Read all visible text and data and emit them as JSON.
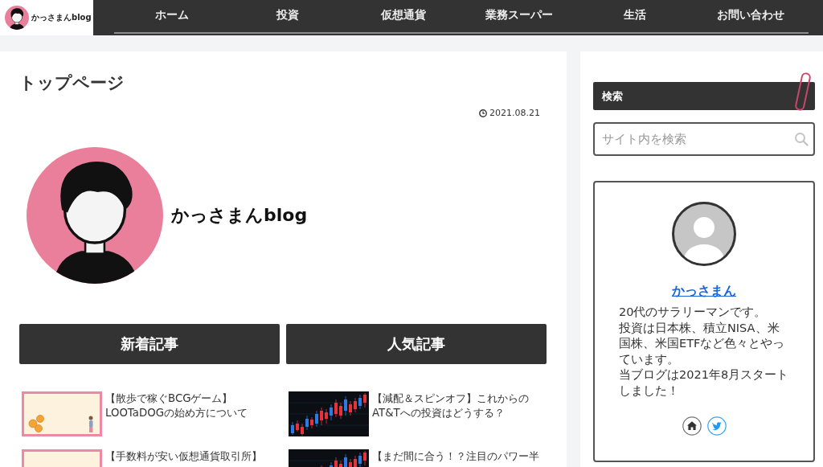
{
  "header": {
    "logo_text": "かっさまんblog",
    "nav": [
      "ホーム",
      "投資",
      "仮想通貨",
      "業務スーパー",
      "生活",
      "お問い合わせ"
    ]
  },
  "main": {
    "title": "トップページ",
    "date": "2021.08.21",
    "blog_name": "かっさまんblog",
    "sections": [
      {
        "heading": "新着記事",
        "articles": [
          {
            "kind": "card",
            "title": "【散歩で稼ぐBCGゲーム】LOOTaDOGの始め方について"
          },
          {
            "kind": "card",
            "title": "【手数料が安い仮想通貨取引所】"
          }
        ]
      },
      {
        "heading": "人気記事",
        "articles": [
          {
            "kind": "chart",
            "title": "【減配＆スピンオフ】これからのAT&Tへの投資はどうする？"
          },
          {
            "kind": "chart",
            "title": "【まだ間に合う！？注目のパワー半"
          }
        ]
      }
    ]
  },
  "sidebar": {
    "search": {
      "heading": "検索",
      "placeholder": "サイト内を検索"
    },
    "profile": {
      "name": "かっさまん",
      "description": [
        "20代のサラリーマンです。",
        "投資は日本株、積立NISA、米国株、米国ETFなど色々とやっています。",
        "当ブログは2021年8月スタートしました！"
      ]
    }
  }
}
